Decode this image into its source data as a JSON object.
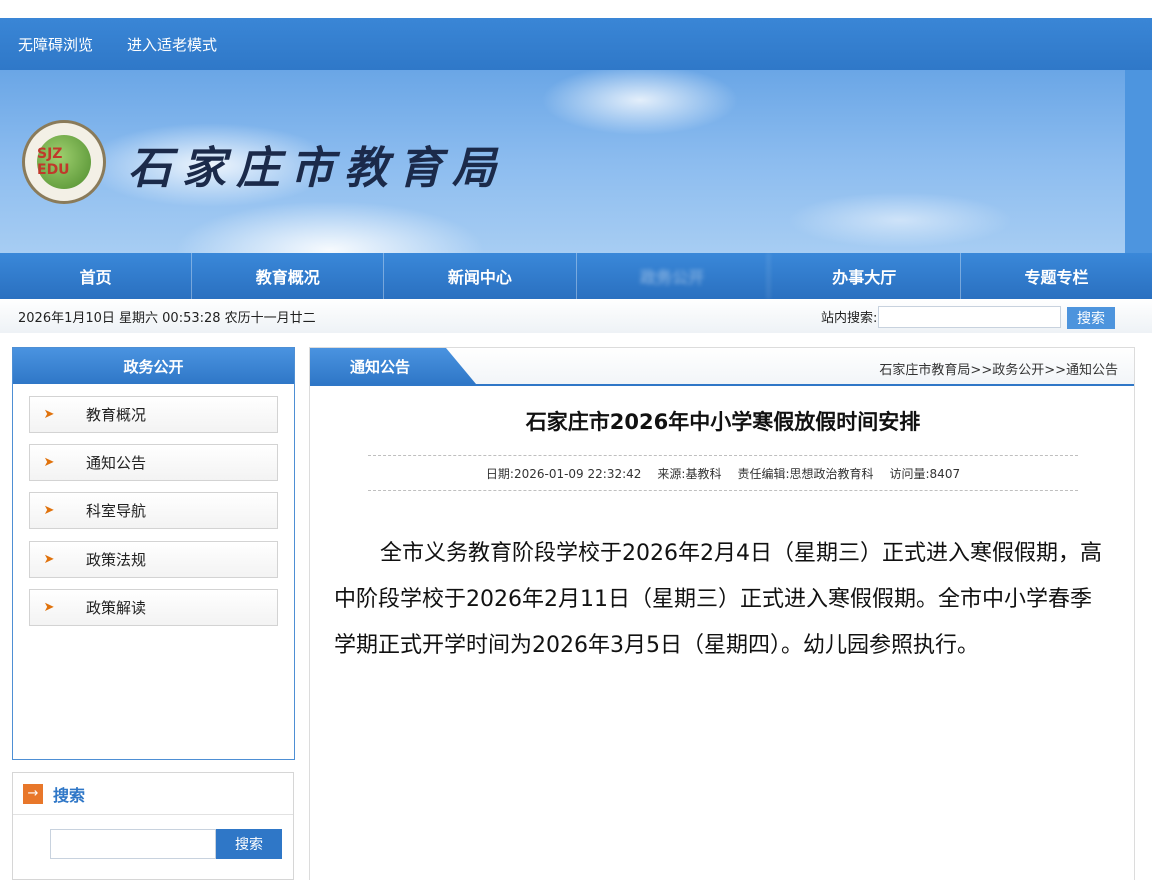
{
  "topbar": {
    "accessible": "无障碍浏览",
    "elder_mode": "进入适老模式"
  },
  "banner": {
    "site_title": "石家庄市教育局",
    "logo_text": "SJZ EDU"
  },
  "nav": {
    "items": [
      "首页",
      "教育概况",
      "新闻中心",
      "政务公开",
      "办事大厅",
      "专题专栏"
    ]
  },
  "infobar": {
    "datetime": "2026年1月10日 星期六 00:53:28 农历十一月廿二",
    "search_label": "站内搜索:",
    "search_button": "搜索"
  },
  "sidebar": {
    "title": "政务公开",
    "items": [
      "教育概况",
      "通知公告",
      "科室导航",
      "政策法规",
      "政策解读"
    ]
  },
  "search_box": {
    "title": "搜索",
    "button": "搜索"
  },
  "content": {
    "tab": "通知公告",
    "breadcrumb": "石家庄市教育局>>政务公开>>通知公告",
    "title": "石家庄市2026年中小学寒假放假时间安排",
    "meta": {
      "date": "日期:2026-01-09 22:32:42",
      "source": "来源:基教科",
      "editor": "责任编辑:思想政治教育科",
      "views": "访问量:8407"
    },
    "body": "全市义务教育阶段学校于2026年2月4日（星期三）正式进入寒假假期，高中阶段学校于2026年2月11日（星期三）正式进入寒假假期。全市中小学春季学期正式开学时间为2026年3月5日（星期四）。幼儿园参照执行。"
  },
  "colors": {
    "primary": "#2f77c7",
    "accent": "#e8772a"
  }
}
